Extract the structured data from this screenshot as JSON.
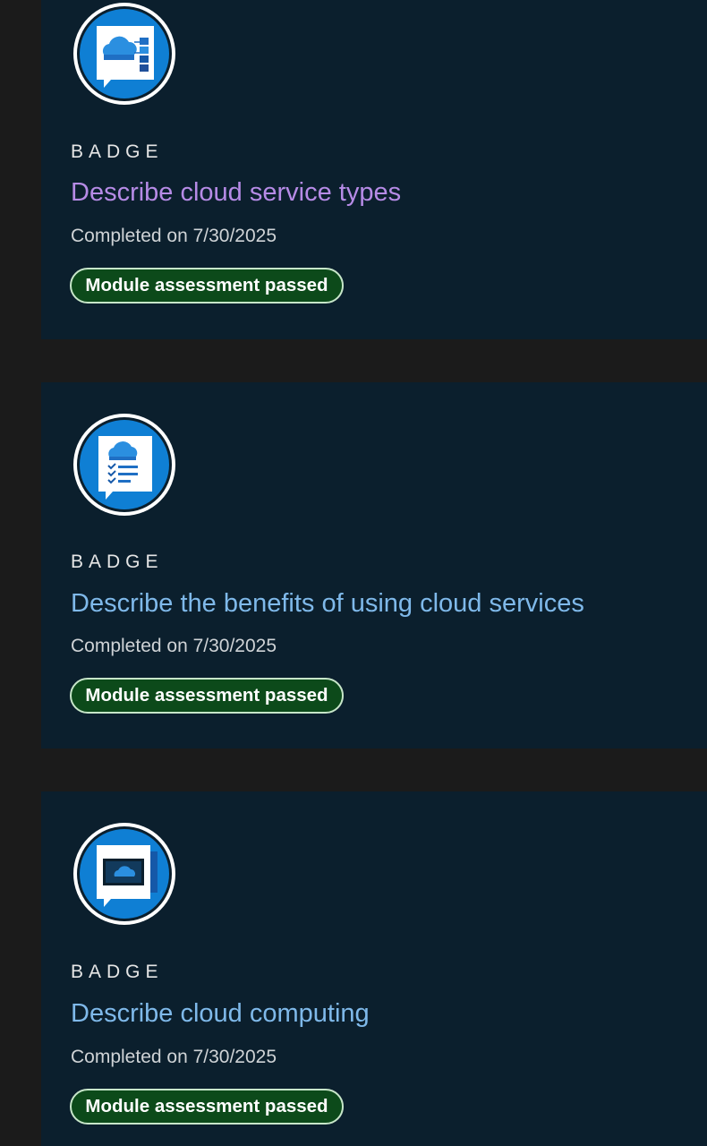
{
  "badges": [
    {
      "kind": "BADGE",
      "title": "Describe cloud service types",
      "completed": "Completed on 7/30/2025",
      "status": "Module assessment passed",
      "icon": "cloud-service-types-icon"
    },
    {
      "kind": "BADGE",
      "title": "Describe the benefits of using cloud services",
      "completed": "Completed on 7/30/2025",
      "status": "Module assessment passed",
      "icon": "cloud-benefits-icon"
    },
    {
      "kind": "BADGE",
      "title": "Describe cloud computing",
      "completed": "Completed on 7/30/2025",
      "status": "Module assessment passed",
      "icon": "cloud-computing-icon"
    }
  ],
  "colors": {
    "page_background": "#1b1b1b",
    "card_background": "#0b1f2d",
    "visited_link": "#b68be6",
    "link": "#7fb9ea",
    "status_pill_fill": "#0c4a1a",
    "status_pill_border": "#c7e6c9",
    "badge_blue": "#0f7fd4"
  }
}
